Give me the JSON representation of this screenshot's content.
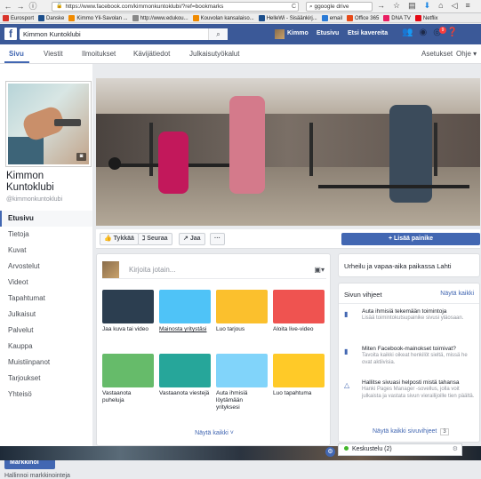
{
  "browser": {
    "url": "https://www.facebook.com/kimmonkuntoklubi/?ref=bookmarks",
    "search_placeholder": "ggoogle drive",
    "bookmarks": [
      {
        "label": "Eurosport",
        "color": "#d9342b"
      },
      {
        "label": "Danske",
        "color": "#1c4f8c"
      },
      {
        "label": "Kimmo Yli-Savolan ...",
        "color": "#f08a00"
      },
      {
        "label": "http://www.edukou...",
        "color": "#888888"
      },
      {
        "label": "Kouvolan kansalaiso...",
        "color": "#f08a00"
      },
      {
        "label": "HelleWi - Sisäänkirj...",
        "color": "#1c4f8c"
      },
      {
        "label": "email",
        "color": "#2a7ad6"
      },
      {
        "label": "Office 365",
        "color": "#e64a19"
      },
      {
        "label": "DNA TV",
        "color": "#e91e63"
      },
      {
        "label": "Netflix",
        "color": "#e50914"
      }
    ]
  },
  "fb": {
    "search_value": "Kimmon Kuntoklubi",
    "nav": [
      "Kimmo",
      "Etusivu",
      "Etsi kavereita"
    ],
    "badge_count": "9"
  },
  "page_nav": {
    "tabs": [
      "Sivu",
      "Viestit",
      "Ilmoitukset",
      "Kävijätiedot",
      "Julkaisutyökalut"
    ],
    "right": [
      "Asetukset",
      "Ohje ▾"
    ]
  },
  "page": {
    "name": "Kimmon Kuntoklubi",
    "handle": "@kimmonkuntoklubi"
  },
  "side_menu": [
    "Etusivu",
    "Tietoja",
    "Kuvat",
    "Arvostelut",
    "Videot",
    "Tapahtumat",
    "Julkaisut",
    "Palvelut",
    "Kauppa",
    "Muistiinpanot",
    "Tarjoukset",
    "Yhteisö"
  ],
  "promote": {
    "label": "Markkinoi",
    "manage": "Hallinnoi markkinointeja"
  },
  "cover_actions": {
    "like": "Tykkää",
    "follow": "Seuraa",
    "share": "Jaa",
    "more": "···",
    "add_button": "+ Lisää painike"
  },
  "composer": {
    "placeholder": "Kirjoita jotain...",
    "tiles": [
      {
        "label": "Jaa kuva tai video",
        "link": false,
        "bg": "#2c3e50"
      },
      {
        "label": "Mainosta yritystäsi",
        "link": true,
        "bg": "#4fc3f7"
      },
      {
        "label": "Luo tarjous",
        "link": false,
        "bg": "#fbc02d"
      },
      {
        "label": "Aloita live-video",
        "link": false,
        "bg": "#ef5350"
      },
      {
        "label": "Vastaanota puheluja",
        "link": false,
        "bg": "#66bb6a"
      },
      {
        "label": "Vastaanota viestejä",
        "link": false,
        "bg": "#26a69a"
      },
      {
        "label": "Auta ihmisiä löytämään yrityksesi",
        "link": false,
        "bg": "#81d4fa"
      },
      {
        "label": "Luo tapahtuma",
        "link": false,
        "bg": "#ffca28"
      }
    ],
    "show_all": "Näytä kaikki ˅"
  },
  "right": {
    "category": "Urheilu ja vapaa-aika paikassa Lahti",
    "tips_title": "Sivun vihjeet",
    "tips_link": "Näytä kaikki",
    "tips": [
      {
        "head": "Auta ihmisiä tekemään toimintoja",
        "body": "Lisää toimintokutsupainike sivusi yläosaan."
      },
      {
        "head": "Miten Facebook-mainokset toimivat?",
        "body": "Tavoita kaikki oikeat henkilöt sieltä, missä he ovat aktiivisia."
      },
      {
        "head": "Hallitse sivuasi helposti mistä tahansa",
        "body": "Hanki Pages Manager -sovellus, jolla voit julkaista ja vastata sivun vierailijoille tien päältä."
      }
    ],
    "tips_more": "Näytä kaikki sivuvihjeet",
    "tips_more_count": "3"
  },
  "chat": {
    "label": "Keskustelu (2)"
  }
}
